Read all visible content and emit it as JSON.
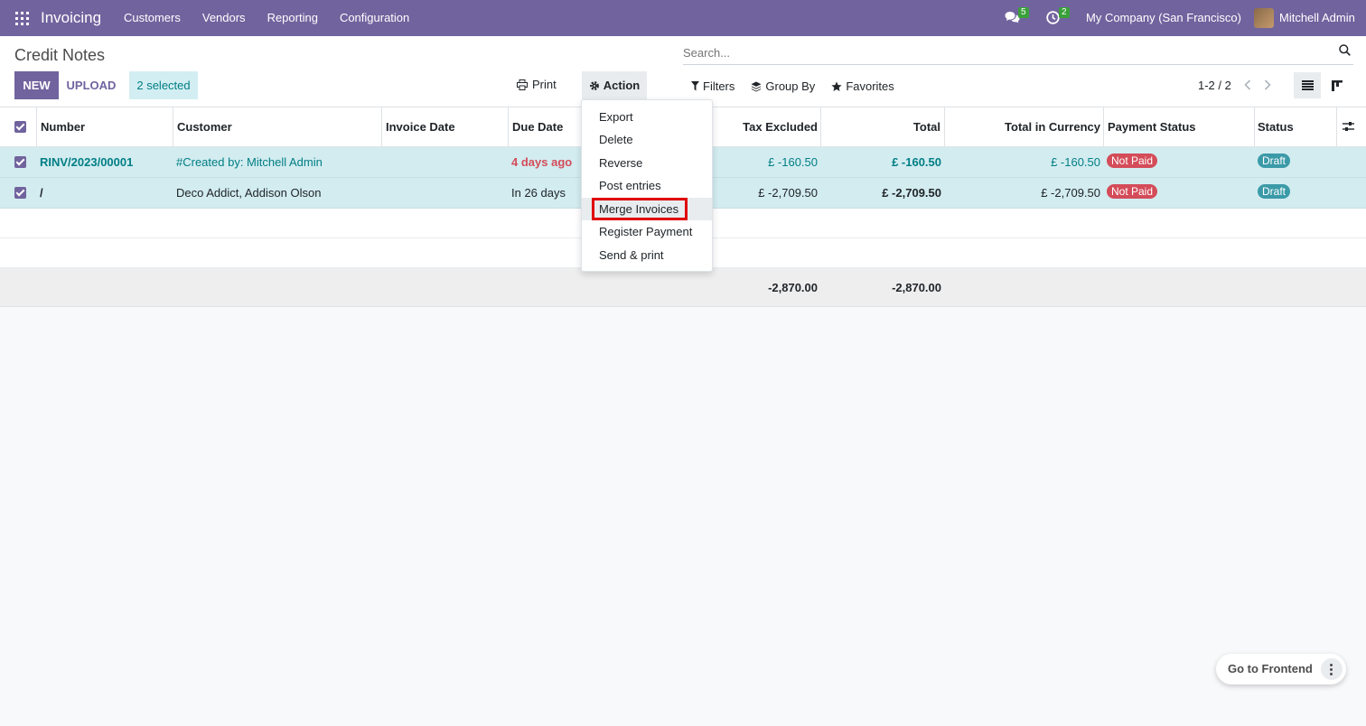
{
  "navbar": {
    "brand": "Invoicing",
    "menu": [
      "Customers",
      "Vendors",
      "Reporting",
      "Configuration"
    ],
    "chat_count": "5",
    "activity_count": "2",
    "company": "My Company (San Francisco)",
    "user": "Mitchell Admin"
  },
  "control": {
    "title": "Credit Notes",
    "new_label": "NEW",
    "upload_label": "UPLOAD",
    "selected_label": "2 selected",
    "print_label": "Print",
    "action_label": "Action",
    "search_placeholder": "Search...",
    "filters_label": "Filters",
    "groupby_label": "Group By",
    "favorites_label": "Favorites",
    "pager": "1-2 / 2"
  },
  "table": {
    "headers": {
      "number": "Number",
      "customer": "Customer",
      "invoice_date": "Invoice Date",
      "due_date": "Due Date",
      "tax_excluded": "Tax Excluded",
      "total": "Total",
      "total_currency": "Total in Currency",
      "payment_status": "Payment Status",
      "status": "Status"
    },
    "rows": [
      {
        "number": "RINV/2023/00001",
        "customer": "#Created by: Mitchell Admin",
        "due_date": "4 days ago",
        "tax_excluded": "£ -160.50",
        "total": "£ -160.50",
        "total_currency": "£ -160.50",
        "payment_status": "Not Paid",
        "status": "Draft"
      },
      {
        "number": "/",
        "customer": "Deco Addict, Addison Olson",
        "due_date": "In 26 days",
        "tax_excluded": "£ -2,709.50",
        "total": "£ -2,709.50",
        "total_currency": "£ -2,709.50",
        "payment_status": "Not Paid",
        "status": "Draft"
      }
    ],
    "footer": {
      "tax_excluded": "-2,870.00",
      "total": "-2,870.00"
    }
  },
  "action_menu": {
    "items": [
      "Export",
      "Delete",
      "Reverse",
      "Post entries",
      "Merge Invoices",
      "Register Payment",
      "Send & print"
    ],
    "highlighted": "Merge Invoices"
  },
  "floating": {
    "frontend_label": "Go to Frontend"
  },
  "colors": {
    "brand": "#71639e",
    "link": "#017e84",
    "danger": "#d44c59",
    "draft": "#3b9aa8",
    "highlight_box": "#e00000"
  }
}
